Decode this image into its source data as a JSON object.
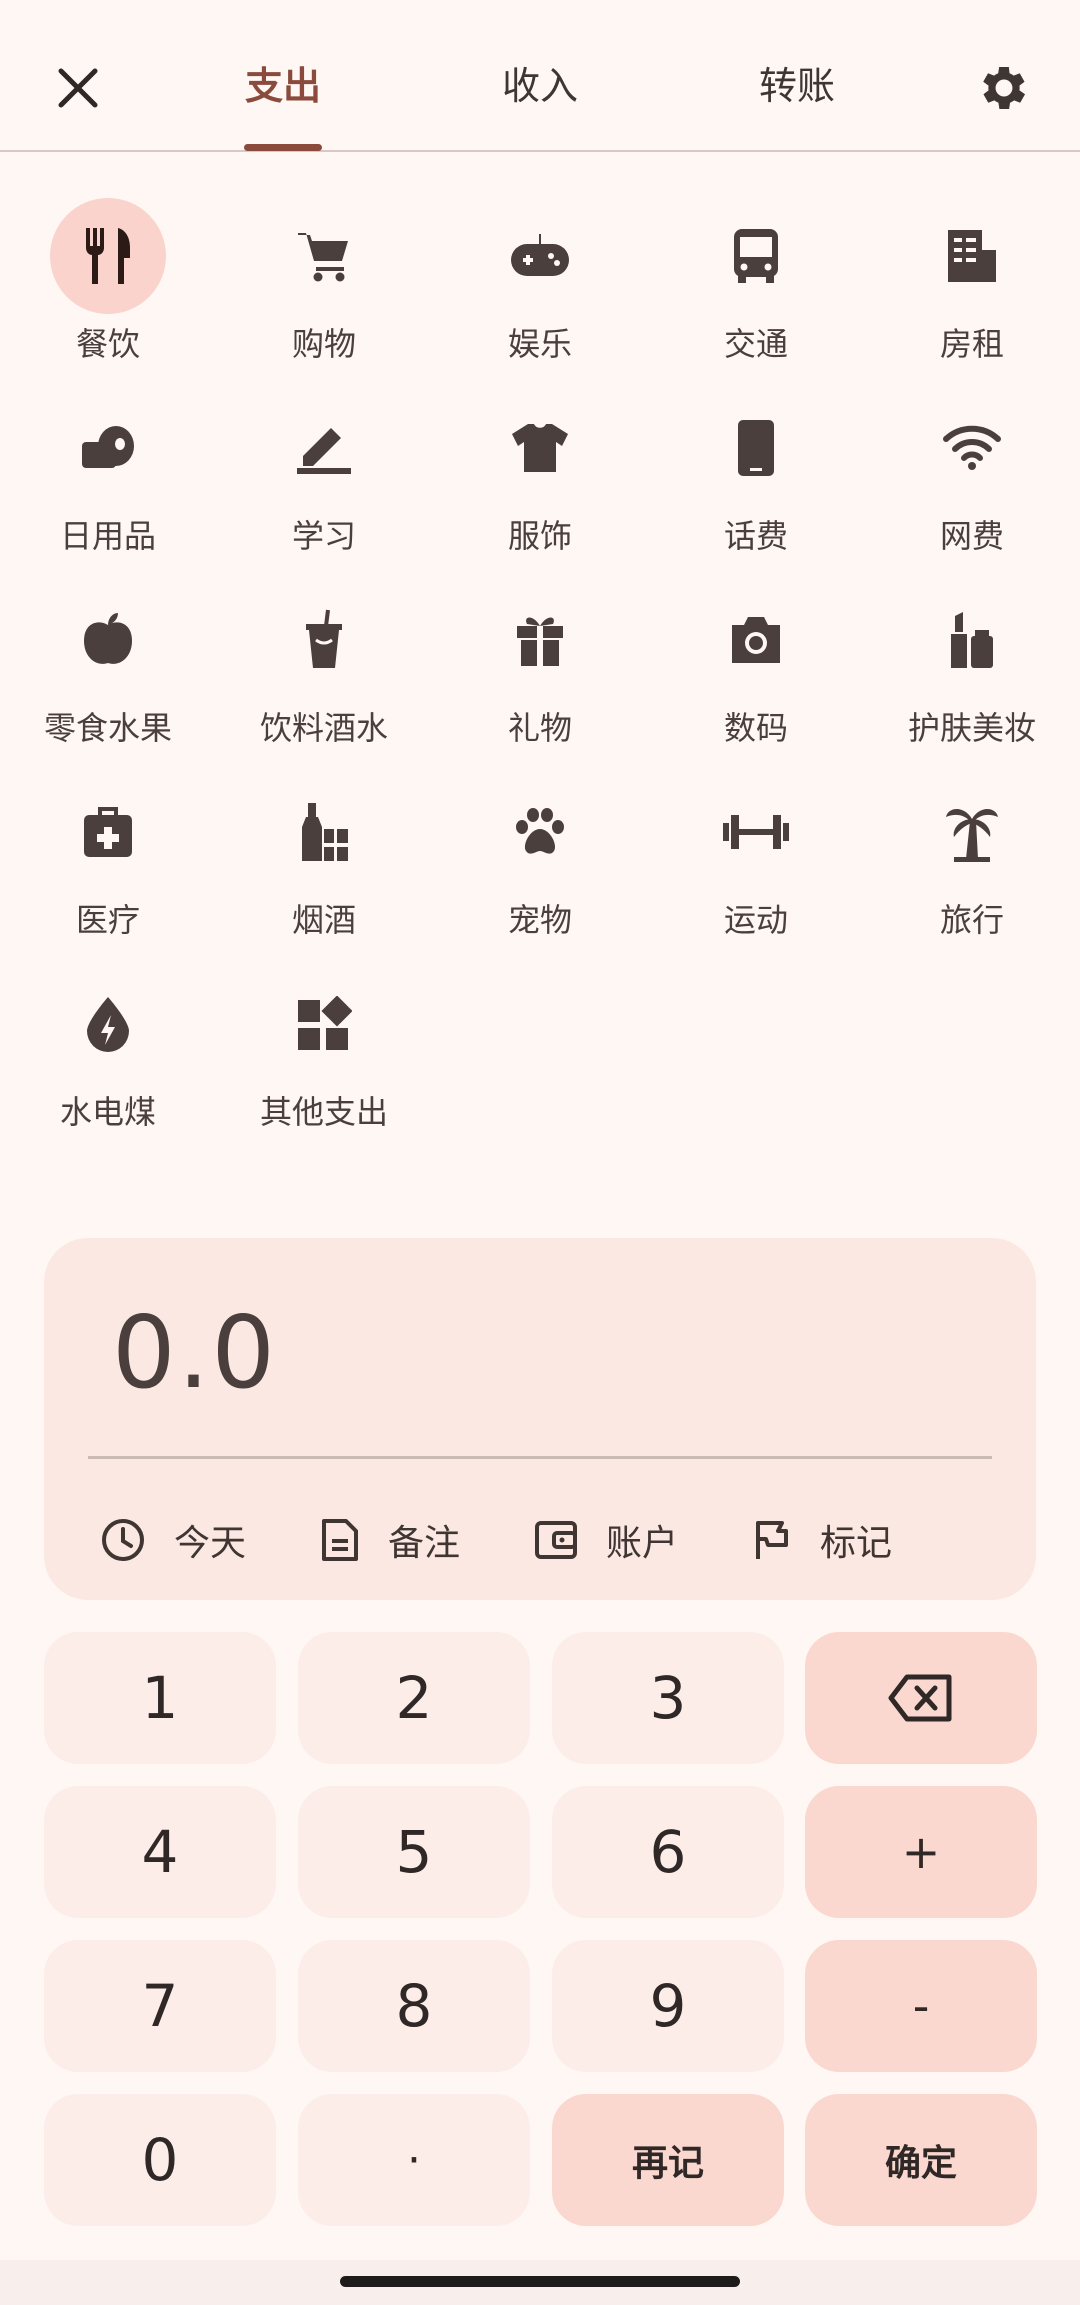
{
  "header": {
    "tabs": [
      {
        "label": "支出",
        "active": true
      },
      {
        "label": "收入",
        "active": false
      },
      {
        "label": "转账",
        "active": false
      }
    ],
    "close_icon": "close-icon",
    "settings_icon": "gear-icon"
  },
  "categories": [
    {
      "label": "餐饮",
      "icon": "utensils-icon",
      "selected": true
    },
    {
      "label": "购物",
      "icon": "cart-icon"
    },
    {
      "label": "娱乐",
      "icon": "gamepad-icon"
    },
    {
      "label": "交通",
      "icon": "bus-icon"
    },
    {
      "label": "房租",
      "icon": "building-icon"
    },
    {
      "label": "日用品",
      "icon": "toilet-paper-icon"
    },
    {
      "label": "学习",
      "icon": "pen-icon"
    },
    {
      "label": "服饰",
      "icon": "tshirt-icon"
    },
    {
      "label": "话费",
      "icon": "phone-icon"
    },
    {
      "label": "网费",
      "icon": "wifi-icon"
    },
    {
      "label": "零食水果",
      "icon": "apple-icon"
    },
    {
      "label": "饮料酒水",
      "icon": "drink-cup-icon"
    },
    {
      "label": "礼物",
      "icon": "gift-icon"
    },
    {
      "label": "数码",
      "icon": "camera-icon"
    },
    {
      "label": "护肤美妆",
      "icon": "lipstick-icon"
    },
    {
      "label": "医疗",
      "icon": "medical-kit-icon"
    },
    {
      "label": "烟酒",
      "icon": "bottle-icon"
    },
    {
      "label": "宠物",
      "icon": "paw-icon"
    },
    {
      "label": "运动",
      "icon": "dumbbell-icon"
    },
    {
      "label": "旅行",
      "icon": "palm-tree-icon"
    },
    {
      "label": "水电煤",
      "icon": "energy-drop-icon"
    },
    {
      "label": "其他支出",
      "icon": "widgets-icon"
    }
  ],
  "amount_panel": {
    "amount": "0.0",
    "chips": [
      {
        "label": "今天",
        "icon": "clock-icon"
      },
      {
        "label": "备注",
        "icon": "note-icon"
      },
      {
        "label": "账户",
        "icon": "wallet-icon"
      },
      {
        "label": "标记",
        "icon": "flag-icon"
      }
    ]
  },
  "keypad": {
    "keys": [
      "1",
      "2",
      "3",
      "⌫",
      "4",
      "5",
      "6",
      "+",
      "7",
      "8",
      "9",
      "-",
      "0",
      "·",
      "再记",
      "确定"
    ]
  },
  "colors": {
    "background": "#FFF7F4",
    "accent": "#8A4A3C",
    "selected_chip": "#FAD4CC",
    "panel": "#FBE8E3",
    "key": "#FCEDE9",
    "key_accent": "#FAD8CF"
  }
}
